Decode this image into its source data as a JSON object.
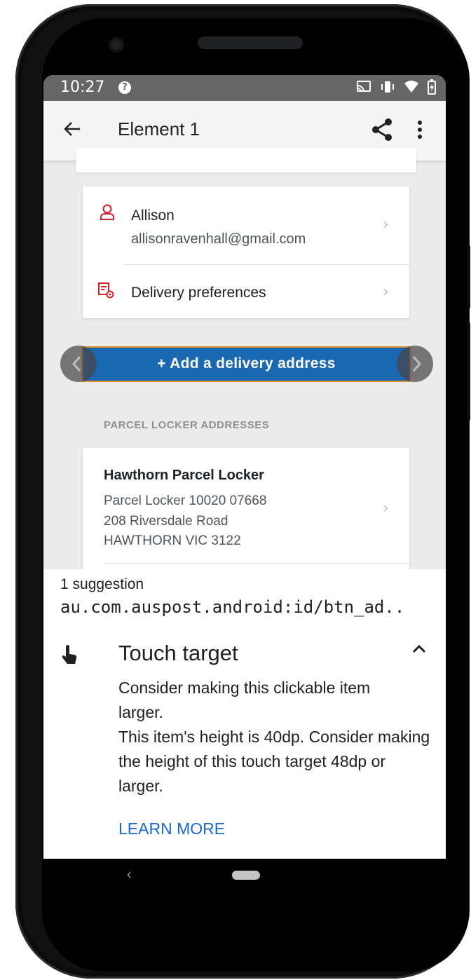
{
  "status_bar": {
    "time": "10:27",
    "notification_icon": "question-mark-icon",
    "icons": [
      "cast-icon",
      "vibrate-icon",
      "wifi-icon",
      "battery-charging-icon"
    ]
  },
  "app_bar": {
    "title": "Element 1",
    "back_icon": "arrow-back-icon",
    "share_icon": "share-icon",
    "more_icon": "more-vert-icon"
  },
  "contact_card": {
    "name": "Allison",
    "email": "allisonravenhall@gmail.com",
    "delivery_preferences_label": "Delivery preferences",
    "chevron": "›"
  },
  "add_address_button": {
    "label": "+  Add a delivery address"
  },
  "parcel_lockers": {
    "section_label": "PARCEL LOCKER ADDRESSES",
    "items": [
      {
        "title": "Hawthorn Parcel Locker",
        "line1": "Parcel Locker 10020 07668",
        "line2": "208 Riversdale Road",
        "line3": "HAWTHORN VIC 3122"
      }
    ]
  },
  "suggestion_panel": {
    "count_text": "1 suggestion",
    "resource_id": "au.com.auspost.android:id/btn_ad..",
    "issue_title": "Touch target",
    "description_1": "Consider making this clickable item larger.",
    "description_2": "This item's height is 40dp. Consider making the height of this touch target 48dp or larger.",
    "learn_more": "LEARN MORE"
  },
  "nav_bar": {
    "back_glyph": "‹"
  },
  "colors": {
    "accent_blue": "#1a67b2",
    "highlight_orange": "#e08a2a",
    "icon_red": "#d6202c",
    "link_blue": "#1967d2"
  }
}
